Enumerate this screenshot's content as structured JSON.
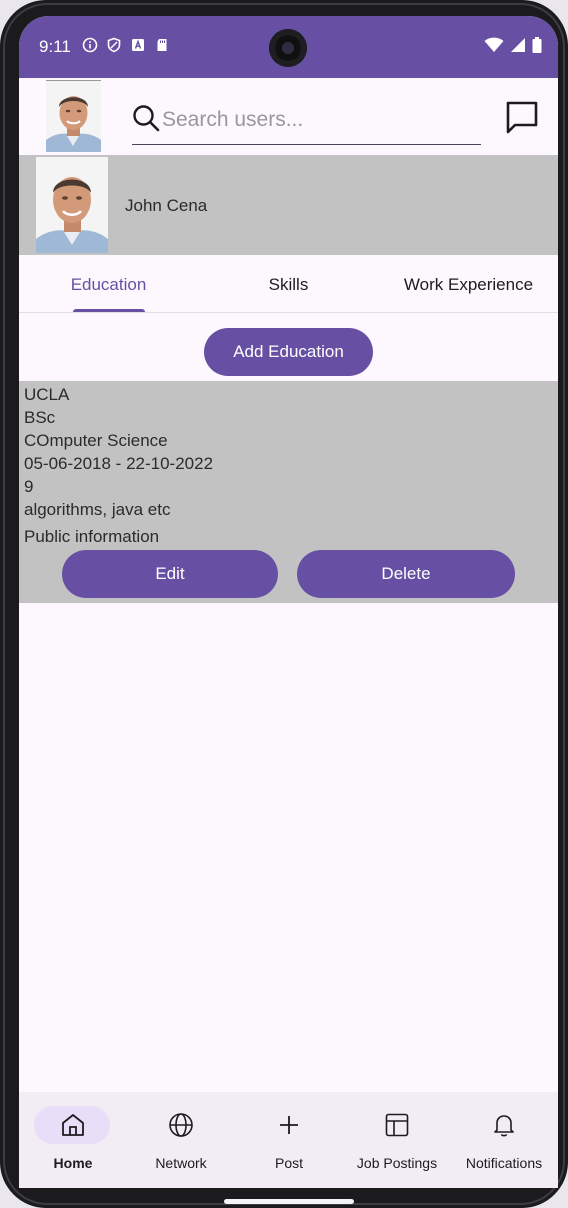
{
  "status_bar": {
    "time": "9:11",
    "icons_left": [
      "info-icon",
      "shield-icon",
      "font-a-icon",
      "sd-card-icon"
    ],
    "icons_right": [
      "wifi-icon",
      "signal-icon",
      "battery-icon"
    ],
    "background": "#6750a4"
  },
  "header": {
    "avatar": "profile-photo",
    "search": {
      "placeholder": "Search users...",
      "value": ""
    },
    "chat_icon": "chat-bubble-icon"
  },
  "profile": {
    "name": "John Cena"
  },
  "tabs": [
    {
      "label": "Education",
      "active": true
    },
    {
      "label": "Skills",
      "active": false
    },
    {
      "label": "Work Experience",
      "active": false
    }
  ],
  "education": {
    "add_label": "Add Education",
    "entries": [
      {
        "school": "UCLA",
        "degree": "BSc",
        "field": "COmputer Science",
        "dates": "05-06-2018 - 22-10-2022",
        "grade": "9",
        "description": "algorithms, java etc",
        "visibility": "Public information",
        "edit_label": "Edit",
        "delete_label": "Delete"
      }
    ]
  },
  "bottom_nav": [
    {
      "label": "Home",
      "icon": "home-icon",
      "active": true
    },
    {
      "label": "Network",
      "icon": "globe-icon",
      "active": false
    },
    {
      "label": "Post",
      "icon": "plus-icon",
      "active": false
    },
    {
      "label": "Job Postings",
      "icon": "layout-icon",
      "active": false
    },
    {
      "label": "Notifications",
      "icon": "bell-icon",
      "active": false
    }
  ],
  "colors": {
    "accent": "#6750a4",
    "card_bg": "#c2c2c2",
    "nav_bg": "#f2ecf4",
    "active_pill": "#e8def8"
  }
}
